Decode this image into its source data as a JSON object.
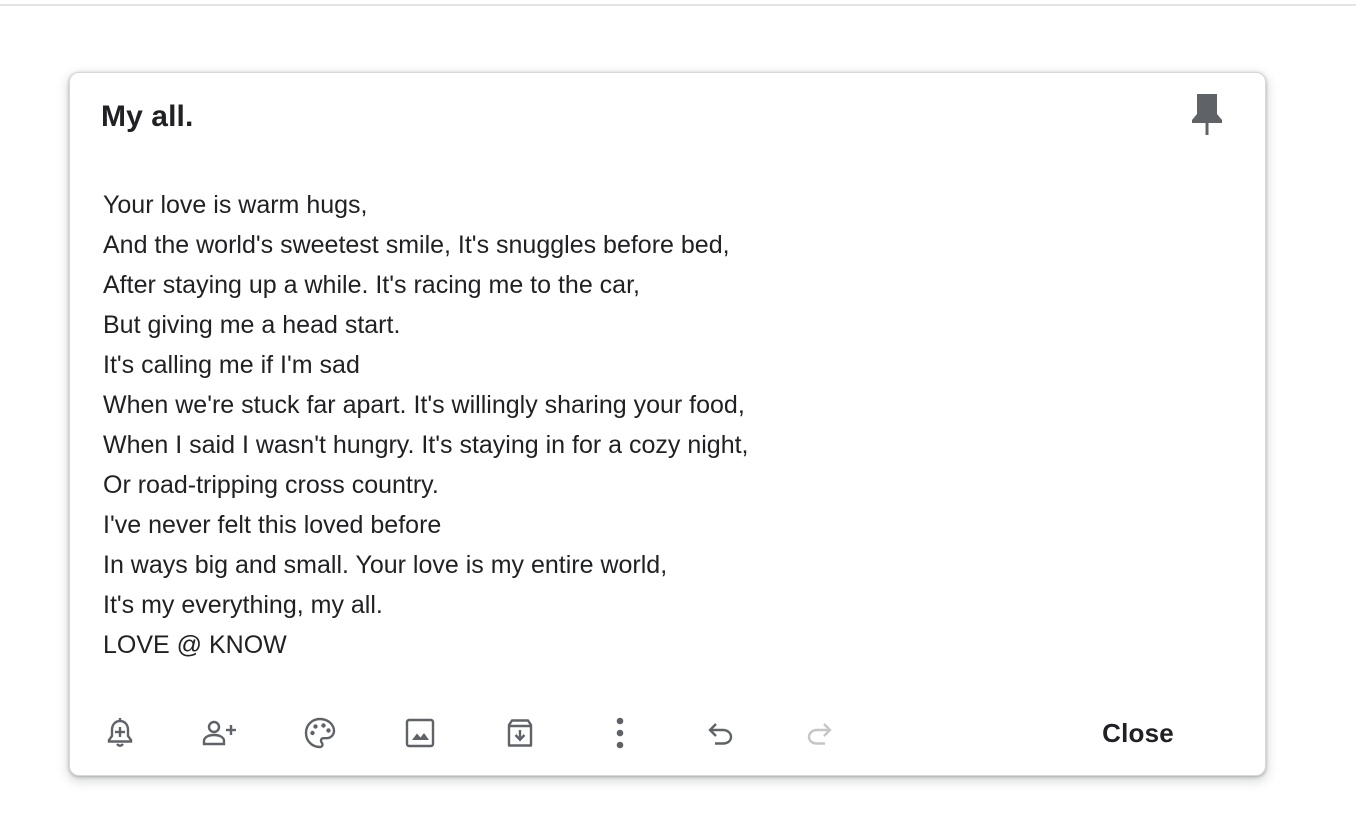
{
  "note": {
    "title": "My all.",
    "lines": [
      "Your love is warm hugs,",
      "And the world's sweetest smile, It's snuggles before bed,",
      "After staying up a while. It's racing me to the car,",
      "But giving me a head start.",
      "It's calling me if I'm sad",
      "When we're stuck far apart. It's willingly sharing your food,",
      "When I said I wasn't hungry. It's staying in for a cozy night,",
      "Or road-tripping cross country.",
      "I've never felt this loved before",
      "In ways big and small. Your love is my entire world,",
      "It's my everything, my all.",
      "LOVE @ KNOW"
    ],
    "pinned": true
  },
  "toolbar": {
    "icons": [
      "add-reminder-icon",
      "collaborator-icon",
      "palette-icon",
      "image-icon",
      "archive-icon",
      "more-vert-icon",
      "undo-icon",
      "redo-icon"
    ],
    "redo_enabled": false,
    "close_label": "Close"
  },
  "colors": {
    "icon": "#5f6368",
    "icon_disabled": "#c4c7c5",
    "text": "#202124"
  }
}
